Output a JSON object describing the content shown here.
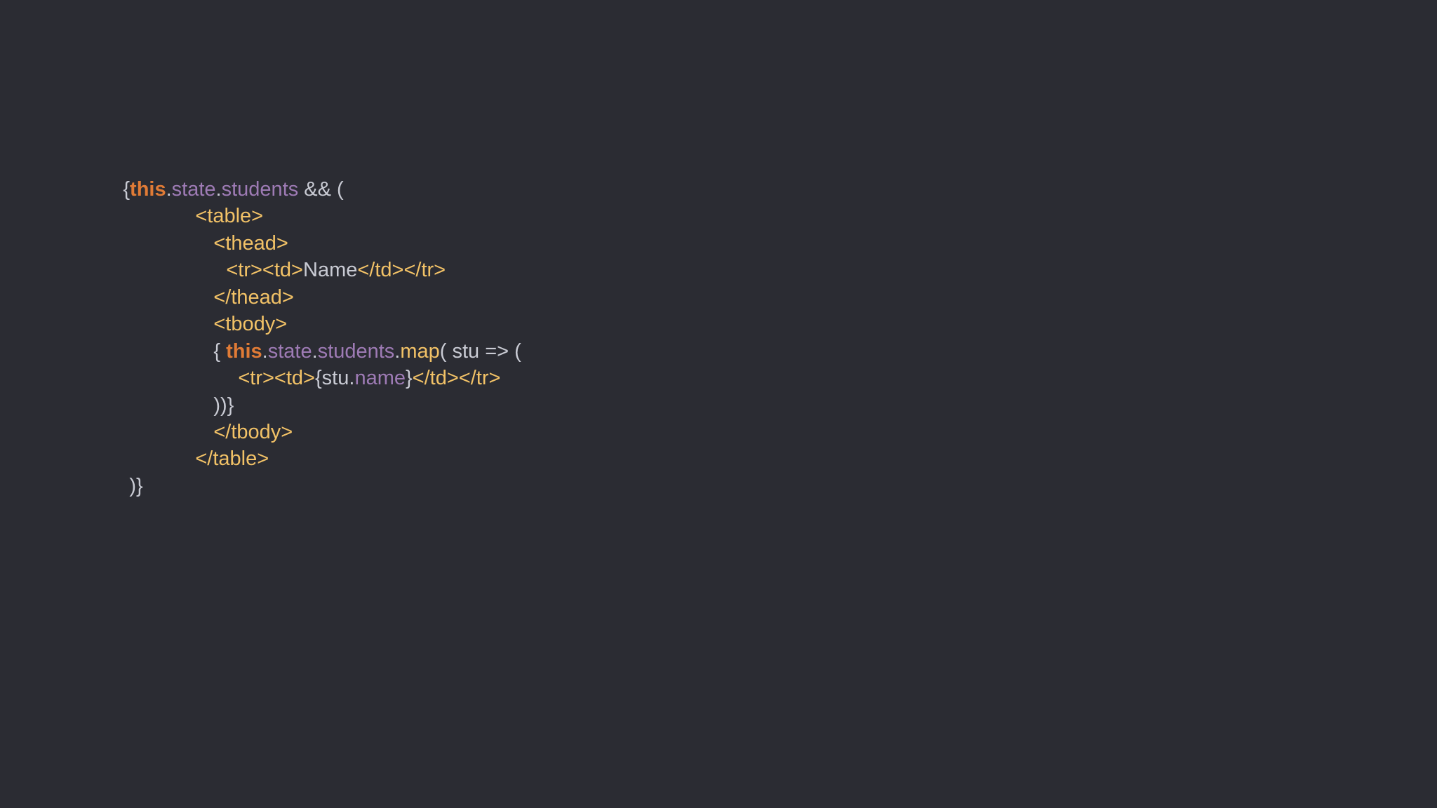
{
  "code": {
    "lines": [
      [
        {
          "text": "{",
          "kind": "plain"
        },
        {
          "text": "this",
          "kind": "keyword"
        },
        {
          "text": ".",
          "kind": "plain"
        },
        {
          "text": "state",
          "kind": "prop"
        },
        {
          "text": ".",
          "kind": "plain"
        },
        {
          "text": "students",
          "kind": "prop"
        },
        {
          "text": " && (",
          "kind": "plain"
        }
      ],
      [
        {
          "text": "<table>",
          "kind": "tag"
        }
      ],
      [
        {
          "text": "<thead>",
          "kind": "tag"
        }
      ],
      [
        {
          "text": "<tr><td>",
          "kind": "tag"
        },
        {
          "text": "Name",
          "kind": "plain"
        },
        {
          "text": "</td></tr>",
          "kind": "tag"
        }
      ],
      [
        {
          "text": "</thead>",
          "kind": "tag"
        }
      ],
      [
        {
          "text": "<tbody>",
          "kind": "tag"
        }
      ],
      [
        {
          "text": "{ ",
          "kind": "plain"
        },
        {
          "text": "this",
          "kind": "keyword"
        },
        {
          "text": ".",
          "kind": "plain"
        },
        {
          "text": "state",
          "kind": "prop"
        },
        {
          "text": ".",
          "kind": "plain"
        },
        {
          "text": "students",
          "kind": "prop"
        },
        {
          "text": ".",
          "kind": "plain"
        },
        {
          "text": "map",
          "kind": "method"
        },
        {
          "text": "( stu => (",
          "kind": "plain"
        }
      ],
      [
        {
          "text": "<tr><td>",
          "kind": "tag"
        },
        {
          "text": "{stu.",
          "kind": "plain"
        },
        {
          "text": "name",
          "kind": "prop"
        },
        {
          "text": "}",
          "kind": "plain"
        },
        {
          "text": "</td></tr>",
          "kind": "tag"
        }
      ],
      [
        {
          "text": "))}",
          "kind": "plain"
        }
      ],
      [
        {
          "text": "</tbody>",
          "kind": "tag"
        }
      ],
      [
        {
          "text": "</table>",
          "kind": "tag"
        }
      ],
      [
        {
          "text": ")}",
          "kind": "plain"
        }
      ]
    ]
  },
  "colors": {
    "background": "#2b2c33",
    "plain": "#c9cbd4",
    "keyword": "#e07b36",
    "property": "#9e7bb5",
    "tag": "#f2c267"
  }
}
